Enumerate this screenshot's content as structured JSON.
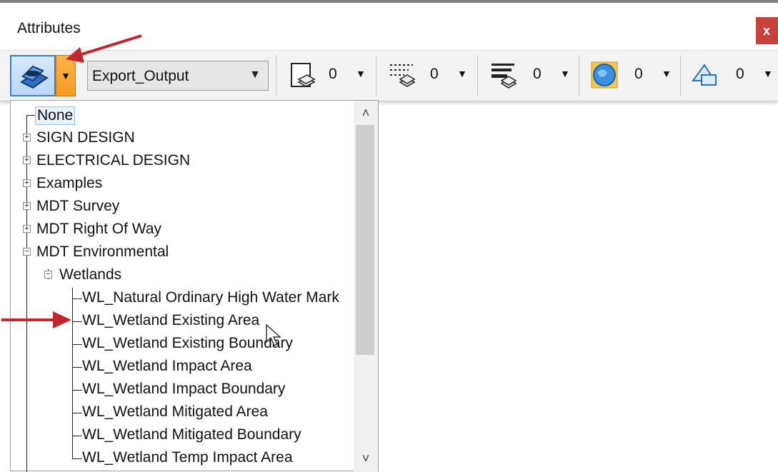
{
  "window": {
    "title": "Attributes",
    "close_label": "x"
  },
  "toolbar": {
    "workspace_icon": "level-display-icon",
    "workspace_dropdown_icon": "chevron-down-icon",
    "active_level": "Export_Output",
    "filters": [
      {
        "icon": "level-stack-icon",
        "count": "0"
      },
      {
        "icon": "dashed-level-stack-icon",
        "count": "0"
      },
      {
        "icon": "weighted-level-stack-icon",
        "count": "0"
      },
      {
        "icon": "globe-icon",
        "count": "0"
      },
      {
        "icon": "shape-icon",
        "count": "0"
      }
    ]
  },
  "tree": {
    "items": [
      {
        "label": "None",
        "selected": true
      },
      {
        "label": "SIGN DESIGN",
        "expander": "+"
      },
      {
        "label": "ELECTRICAL DESIGN",
        "expander": "+"
      },
      {
        "label": "Examples",
        "expander": "+"
      },
      {
        "label": "MDT Survey",
        "expander": "+"
      },
      {
        "label": "MDT Right Of Way",
        "expander": "+"
      },
      {
        "label": "MDT Environmental",
        "expander": "−"
      },
      {
        "label": "Wetlands",
        "expander": "−"
      },
      {
        "label": "WL_Natural Ordinary High Water Mark"
      },
      {
        "label": "WL_Wetland Existing Area"
      },
      {
        "label": "WL_Wetland Existing Boundary"
      },
      {
        "label": "WL_Wetland Impact Area"
      },
      {
        "label": "WL_Wetland Impact Boundary"
      },
      {
        "label": "WL_Wetland Mitigated Area"
      },
      {
        "label": "WL_Wetland Mitigated Boundary"
      },
      {
        "label": "WL_Wetland Temp Impact Area"
      }
    ],
    "scroll_up": "˄",
    "scroll_down": "˅"
  },
  "colors": {
    "accent_orange": "#f59a1e",
    "annotation_red": "#c0282d",
    "close_red": "#c8413c"
  }
}
